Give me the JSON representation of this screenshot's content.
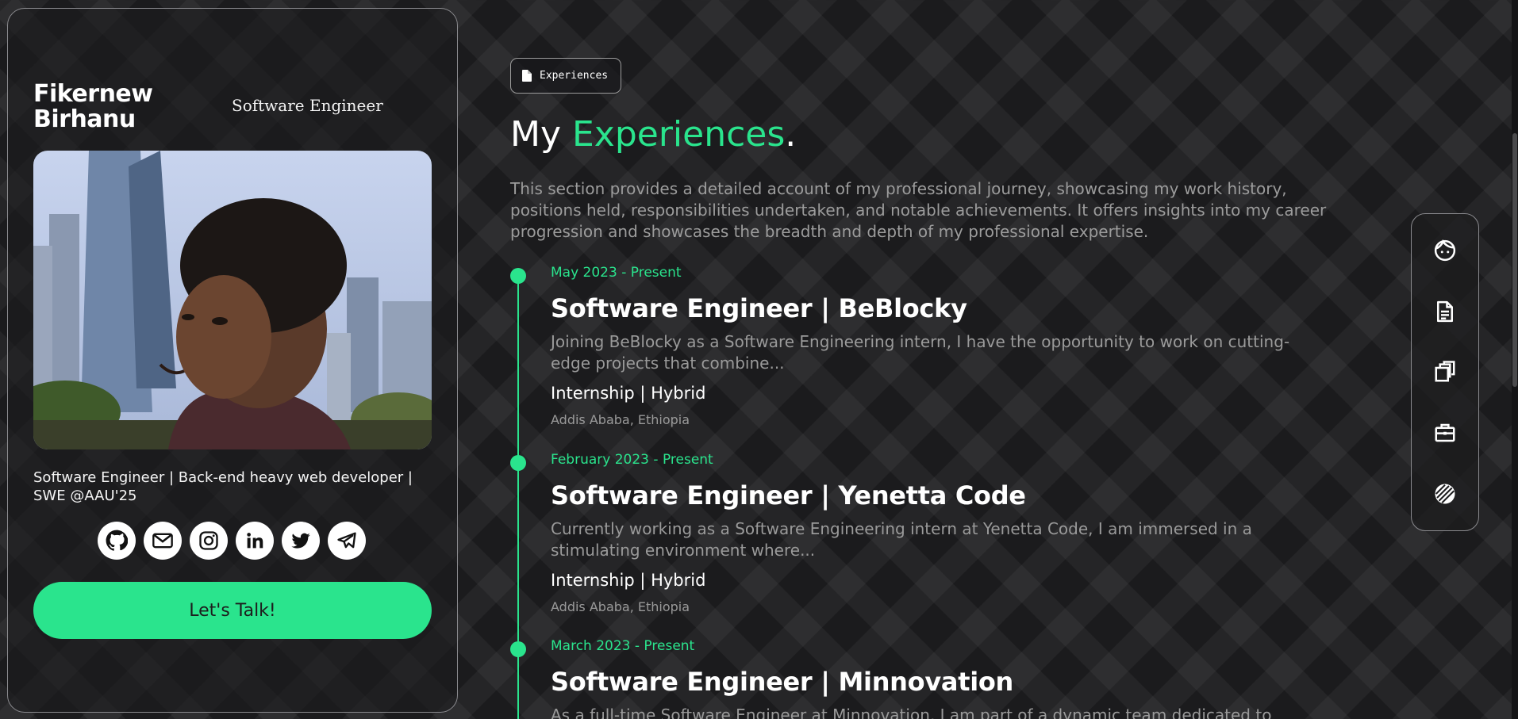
{
  "profile": {
    "name_line1": "Fikernew",
    "name_line2": "Birhanu",
    "role": "Software Engineer",
    "bio": "Software Engineer | Back-end heavy web developer | SWE @AAU'25",
    "social": [
      "github-icon",
      "gmail-icon",
      "instagram-icon",
      "linkedin-icon",
      "twitter-icon",
      "telegram-icon"
    ],
    "cta_label": "Let's Talk!"
  },
  "section": {
    "chip_label": "Experiences",
    "title_prefix": "My ",
    "title_accent": "Experiences",
    "title_suffix": ".",
    "intro": "This section provides a detailed account of my professional journey, showcasing my work history, positions held, responsibilities undertaken, and notable achievements. It offers insights into my career progression and showcases the breadth and depth of my professional expertise."
  },
  "experiences": [
    {
      "date": "May 2023 - Present",
      "title": "Software Engineer | BeBlocky",
      "description": "Joining BeBlocky as a Software Engineering intern, I have the opportunity to work on cutting-edge projects that combine...",
      "type": "Internship | Hybrid",
      "location": "Addis Ababa, Ethiopia"
    },
    {
      "date": "February 2023 - Present",
      "title": "Software Engineer | Yenetta Code",
      "description": "Currently working as a Software Engineering intern at Yenetta Code, I am immersed in a stimulating environment where...",
      "type": "Internship | Hybrid",
      "location": "Addis Ababa, Ethiopia"
    },
    {
      "date": "March 2023 - Present",
      "title": "Software Engineer | Minnovation",
      "description": "As a full-time Software Engineer at Minnovation, I am part of a dynamic team dedicated to"
    }
  ],
  "side_nav": [
    "face-icon",
    "resume-icon",
    "portfolio-icon",
    "briefcase-icon",
    "contact-icon"
  ],
  "colors": {
    "accent": "#2ae48d",
    "background": "#1b1b1d",
    "muted_text": "#9c9c9c"
  }
}
